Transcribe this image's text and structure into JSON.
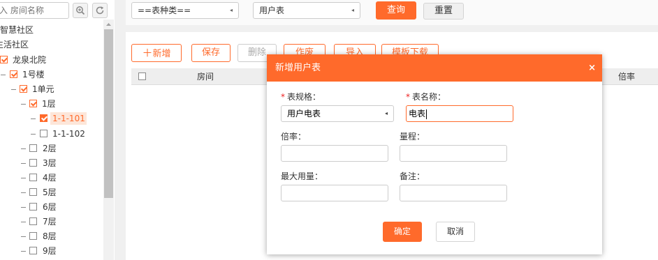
{
  "tree": {
    "search_placeholder": "入 房间名称",
    "nodes": [
      {
        "label": "智慧社区"
      },
      {
        "label": "生活社区"
      },
      {
        "label": "龙泉北院"
      },
      {
        "label": "1号楼"
      },
      {
        "label": "1单元"
      },
      {
        "label": "1层"
      },
      {
        "label": "1-1-101"
      },
      {
        "label": "1-1-102"
      },
      {
        "label": "2层"
      },
      {
        "label": "3层"
      },
      {
        "label": "4层"
      },
      {
        "label": "5层"
      },
      {
        "label": "6层"
      },
      {
        "label": "7层"
      },
      {
        "label": "8层"
      },
      {
        "label": "9层"
      }
    ],
    "icons": {
      "search": "zoom-in-icon",
      "refresh": "refresh-icon"
    }
  },
  "filter": {
    "meter_type_select": "==表种类==",
    "meter_select": "用户表",
    "query_label": "查询",
    "reset_label": "重置"
  },
  "toolbar": {
    "add_label": "新增",
    "save_label": "保存",
    "delete_label": "删除",
    "btn4_label": "作废",
    "import_label": "导入",
    "template_label": "模板下载"
  },
  "table": {
    "columns": [
      "房间",
      "倍率"
    ]
  },
  "modal": {
    "title": "新增用户表",
    "close_glyph": "×",
    "fields": {
      "spec_label": "表规格：",
      "spec_value": "用户电表",
      "name_label": "表名称：",
      "name_value": "电表",
      "ratio_label": "倍率：",
      "ratio_value": "",
      "range_label": "量程：",
      "range_value": "",
      "max_label": "最大用量：",
      "max_value": "",
      "remark_label": "备注：",
      "remark_value": ""
    },
    "confirm_label": "确定",
    "cancel_label": "取消"
  },
  "colors": {
    "accent": "#ff6a2b",
    "selected_bg": "#fde6d9"
  }
}
